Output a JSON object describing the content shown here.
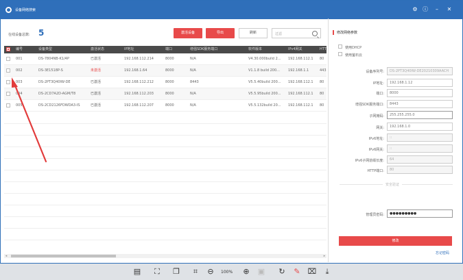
{
  "window": {
    "title": "设备网络搜索"
  },
  "toolbar_top": {
    "found_label": "在线设备总数:",
    "found_count": "5",
    "activate_button": "激活设备",
    "export_button": "导出",
    "refresh_button": "刷新",
    "filter_placeholder": "过滤"
  },
  "table": {
    "headers": [
      "编号",
      "设备类型",
      "激活状态",
      "IP地址",
      "端口",
      "增强SDK服务端口",
      "软件版本",
      "IPv4网关",
      "HTTP"
    ],
    "rows": [
      [
        "001",
        "DS-7804NB-K1/4P",
        "已激活",
        "192.168.112.214",
        "8000",
        "N/A",
        "V4.30.000build 2...",
        "192.168.112.1",
        "80"
      ],
      [
        "002",
        "DS-3E1518P-S",
        "未激活",
        "192.168.1.64",
        "8000",
        "N/A",
        "V1.1.8 build 200...",
        "192.168.1.1",
        "443"
      ],
      [
        "003",
        "DS-2PT3Q40IW-DE",
        "已激活",
        "192.168.112.212",
        "8000",
        "8443",
        "V5.5.40build 200...",
        "192.168.112.1",
        "80"
      ],
      [
        "004",
        "DS-2CD7A2D-AGM/T8",
        "已激活",
        "192.168.112.203",
        "8000",
        "N/A",
        "V5.5.95build 200...",
        "192.168.112.1",
        "80"
      ],
      [
        "005",
        "DS-2CD2126FDWDA3-IS",
        "已激活",
        "192.168.112.207",
        "8000",
        "N/A",
        "V5.5.132build 20...",
        "192.168.112.1",
        "80"
      ]
    ]
  },
  "panel": {
    "title": "修改网络参数",
    "dhcp_label": "使用DHCP",
    "hik_connect_label": "使用萤石云",
    "fields": [
      {
        "label": "设备序列号:",
        "value": "DS-2PT3Q40IW-DE20210309AACH"
      },
      {
        "label": "IP地址:",
        "value": "192.168.1.12"
      },
      {
        "label": "端口:",
        "value": "8000"
      },
      {
        "label": "增强SDK服务端口:",
        "value": "8443"
      },
      {
        "label": "子网掩码:",
        "value": "255.255.255.0"
      },
      {
        "label": "网关:",
        "value": "192.168.1.0"
      },
      {
        "label": "IPv6地址:",
        "value": "::"
      },
      {
        "label": "IPv6网关:",
        "value": "::"
      },
      {
        "label": "IPv6子网前缀长度:",
        "value": "64"
      },
      {
        "label": "HTTP端口:",
        "value": "80"
      }
    ],
    "auth_section": "安全验证",
    "password_label": "管理员密码:",
    "password_value": "●●●●●●●●●",
    "save_button": "修改",
    "forgot_link": "忘记密码"
  },
  "bottom_toolbar": {
    "zoom": "100%"
  },
  "colors": {
    "accent_blue": "#2f6fba",
    "accent_red": "#e84a4a"
  }
}
